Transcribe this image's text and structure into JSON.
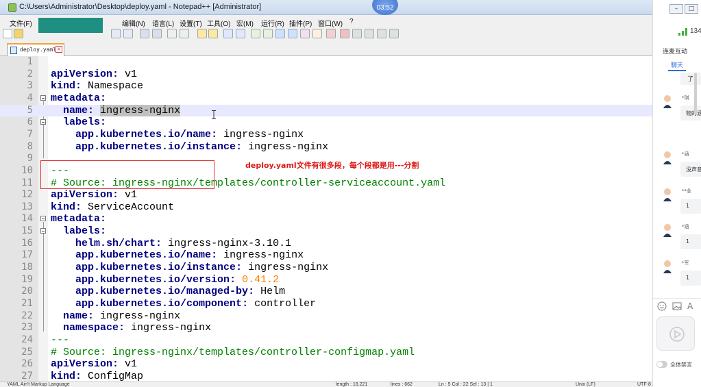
{
  "window": {
    "title": "C:\\Users\\Administrator\\Desktop\\deploy.yaml - Notepad++ [Administrator]",
    "timer": "03:52"
  },
  "menu": [
    {
      "label": "文件(F)"
    },
    {
      "label": "编辑(N)"
    },
    {
      "label": "语言(L)"
    },
    {
      "label": "设置(T)"
    },
    {
      "label": "工具(O)"
    },
    {
      "label": "宏(M)"
    },
    {
      "label": "运行(R)"
    },
    {
      "label": "插件(P)"
    },
    {
      "label": "窗口(W)"
    },
    {
      "label": "?"
    }
  ],
  "tab": {
    "label": "deploy.yaml"
  },
  "editor": {
    "lines": [
      {
        "n": "1"
      },
      {
        "n": "2"
      },
      {
        "n": "3"
      },
      {
        "n": "4"
      },
      {
        "n": "5"
      },
      {
        "n": "6"
      },
      {
        "n": "7"
      },
      {
        "n": "8"
      },
      {
        "n": "9"
      },
      {
        "n": "10"
      },
      {
        "n": "11"
      },
      {
        "n": "12"
      },
      {
        "n": "13"
      },
      {
        "n": "14"
      },
      {
        "n": "15"
      },
      {
        "n": "16"
      },
      {
        "n": "17"
      },
      {
        "n": "18"
      },
      {
        "n": "19"
      },
      {
        "n": "20"
      },
      {
        "n": "21"
      },
      {
        "n": "22"
      },
      {
        "n": "23"
      },
      {
        "n": "24"
      },
      {
        "n": "25"
      },
      {
        "n": "26"
      },
      {
        "n": "27"
      }
    ],
    "code": {
      "l2_key": "apiVersion",
      "l2_val": " v1",
      "l3_key": "kind",
      "l3_val": " Namespace",
      "l4_key": "metadata",
      "l5_key": "name",
      "l5_val": "ingress-nginx",
      "l6_key": "labels",
      "l7_key": "app.kubernetes.io/name",
      "l7_val": " ingress-nginx",
      "l8_key": "app.kubernetes.io/instance",
      "l8_val": " ingress-nginx",
      "l10": "---",
      "l11": "# Source: ingress-nginx/templates/controller-serviceaccount.yaml",
      "l12_key": "apiVersion",
      "l12_val": " v1",
      "l13_key": "kind",
      "l13_val": " ServiceAccount",
      "l14_key": "metadata",
      "l15_key": "labels",
      "l16_key": "helm.sh/chart",
      "l16_val": " ingress-nginx-3.10.1",
      "l17_key": "app.kubernetes.io/name",
      "l17_val": " ingress-nginx",
      "l18_key": "app.kubernetes.io/instance",
      "l18_val": " ingress-nginx",
      "l19_key": "app.kubernetes.io/version",
      "l19_val": " 0.41.2",
      "l20_key": "app.kubernetes.io/managed-by",
      "l20_val": " Helm",
      "l21_key": "app.kubernetes.io/component",
      "l21_val": " controller",
      "l22_key": "name",
      "l22_val": " ingress-nginx",
      "l23_key": "namespace",
      "l23_val": " ingress-nginx",
      "l24": "---",
      "l25": "# Source: ingress-nginx/templates/controller-configmap.yaml",
      "l26_key": "apiVersion",
      "l26_val": " v1",
      "l27_key": "kind",
      "l27_val": " ConfigMap"
    }
  },
  "annotation": "deploy.yaml文件有很多段，每个段都是用---分割",
  "status": {
    "language": "YAML Ain't Markup Language",
    "length": "length : 18,221",
    "lines": "lines : 662",
    "position": "Ln : 5    Col : 22    Sel : 13 | 1",
    "eol": "Unix (LF)",
    "encoding": "UTF-8"
  },
  "panel": {
    "signal_count": "134",
    "title": "连麦互动",
    "tab_chat": "聊天",
    "first_msg": "了",
    "messages": [
      {
        "name": "*琪",
        "text": "物的涵"
      },
      {
        "name": "*涵",
        "text": "没声音"
      },
      {
        "name": "**业",
        "text": "1"
      },
      {
        "name": "*涵",
        "text": "1"
      },
      {
        "name": "*军",
        "text": "1"
      }
    ],
    "mute_label": "全体禁言"
  },
  "colors": {
    "keyword": "#000080",
    "comment": "#008000",
    "number": "#ff8000",
    "annotation": "#e01818",
    "current_line": "#e8e8ff"
  }
}
